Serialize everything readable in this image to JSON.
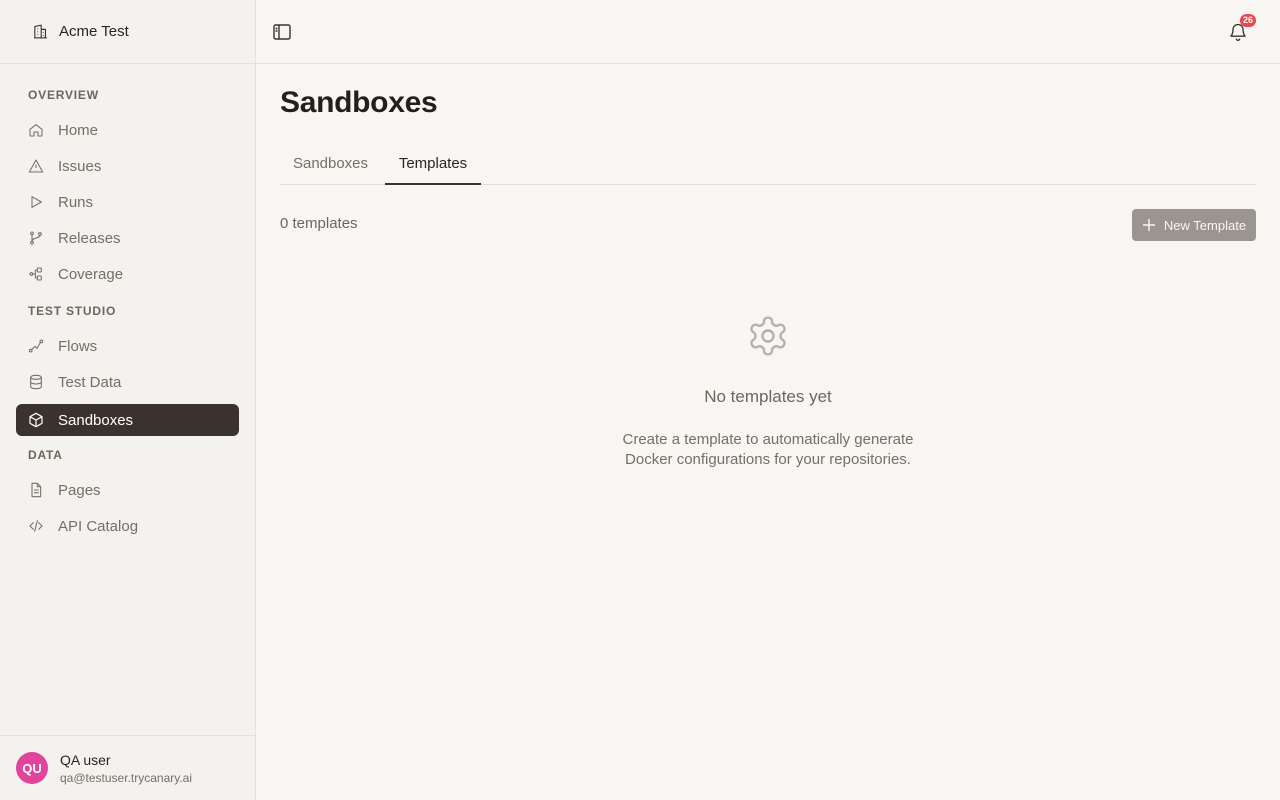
{
  "org": {
    "name": "Acme Test",
    "icon": "building-icon"
  },
  "sidebar": {
    "sections": [
      {
        "label": "OVERVIEW"
      },
      {
        "label": "TEST STUDIO"
      },
      {
        "label": "DATA"
      }
    ],
    "items": [
      {
        "label": "Home",
        "icon": "home-icon"
      },
      {
        "label": "Issues",
        "icon": "warning-icon"
      },
      {
        "label": "Runs",
        "icon": "play-icon"
      },
      {
        "label": "Releases",
        "icon": "git-branch-icon"
      },
      {
        "label": "Coverage",
        "icon": "coverage-icon"
      },
      {
        "label": "Flows",
        "icon": "flow-icon"
      },
      {
        "label": "Test Data",
        "icon": "database-icon"
      },
      {
        "label": "Sandboxes",
        "icon": "box-icon",
        "active": true
      },
      {
        "label": "Pages",
        "icon": "file-icon"
      },
      {
        "label": "API Catalog",
        "icon": "code-icon"
      }
    ]
  },
  "user": {
    "initials": "QU",
    "name": "QA user",
    "email": "qa@testuser.trycanary.ai"
  },
  "topbar": {
    "notification_count": "26"
  },
  "page": {
    "title": "Sandboxes",
    "tabs": [
      {
        "label": "Sandboxes",
        "active": false
      },
      {
        "label": "Templates",
        "active": true
      }
    ],
    "count_text": "0 templates",
    "new_button_label": "New Template",
    "empty_title": "No templates yet",
    "empty_desc": "Create a template to automatically generate Docker configurations for your repositories."
  },
  "colors": {
    "active_nav": "#3a332d",
    "avatar": "#e0459b",
    "badge": "#e5484d",
    "button": "#9b958f"
  }
}
